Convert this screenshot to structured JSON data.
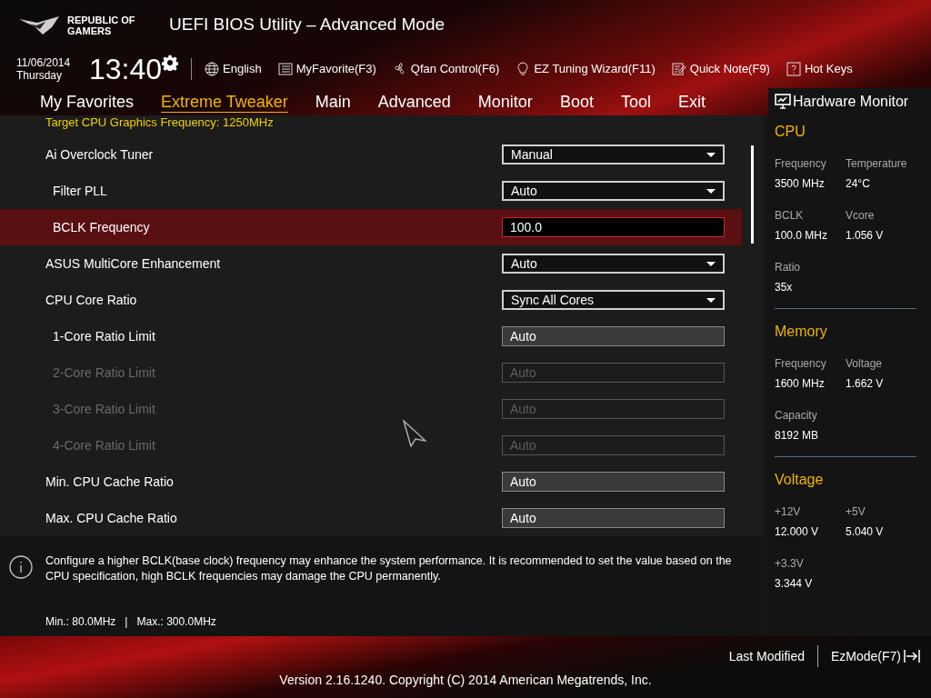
{
  "brand": {
    "line1": "REPUBLIC OF",
    "line2": "GAMERS"
  },
  "window": {
    "title": "UEFI BIOS Utility – Advanced Mode"
  },
  "clock": {
    "date": "11/06/2014",
    "day": "Thursday",
    "time": "13:40"
  },
  "toolbar": [
    "English",
    "MyFavorite(F3)",
    "Qfan Control(F6)",
    "EZ Tuning Wizard(F11)",
    "Quick Note(F9)",
    "Hot Keys"
  ],
  "tabs": [
    {
      "label": "My Favorites",
      "selected": false
    },
    {
      "label": "Extreme Tweaker",
      "selected": true
    },
    {
      "label": "Main",
      "selected": false
    },
    {
      "label": "Advanced",
      "selected": false
    },
    {
      "label": "Monitor",
      "selected": false
    },
    {
      "label": "Boot",
      "selected": false
    },
    {
      "label": "Tool",
      "selected": false
    },
    {
      "label": "Exit",
      "selected": false
    }
  ],
  "top_note": "Target CPU Graphics Frequency: 1250MHz",
  "settings": [
    {
      "label": "Ai Overclock Tuner",
      "value": "Manual",
      "kind": "dropdown",
      "selected": false,
      "disabled": false,
      "children": [
        {
          "label": "Filter PLL",
          "value": "Auto",
          "kind": "dropdown",
          "selected": false,
          "disabled": false
        },
        {
          "label": "BCLK Frequency",
          "value": "100.0",
          "kind": "input",
          "selected": true,
          "disabled": false
        }
      ]
    },
    {
      "label": "ASUS MultiCore Enhancement",
      "value": "Auto",
      "kind": "dropdown",
      "selected": false,
      "disabled": false
    },
    {
      "label": "CPU Core Ratio",
      "value": "Sync All Cores",
      "kind": "dropdown",
      "selected": false,
      "disabled": false,
      "children": [
        {
          "label": "1-Core Ratio Limit",
          "value": "Auto",
          "kind": "box",
          "selected": false,
          "disabled": false
        },
        {
          "label": "2-Core Ratio Limit",
          "value": "Auto",
          "kind": "box",
          "selected": false,
          "disabled": true
        },
        {
          "label": "3-Core Ratio Limit",
          "value": "Auto",
          "kind": "box",
          "selected": false,
          "disabled": true
        },
        {
          "label": "4-Core Ratio Limit",
          "value": "Auto",
          "kind": "box",
          "selected": false,
          "disabled": true
        }
      ]
    },
    {
      "label": "Min. CPU Cache Ratio",
      "value": "Auto",
      "kind": "box",
      "selected": false,
      "disabled": false
    },
    {
      "label": "Max. CPU Cache Ratio",
      "value": "Auto",
      "kind": "box",
      "selected": false,
      "disabled": false
    }
  ],
  "help": {
    "text": "Configure a higher BCLK(base clock) frequency may enhance the system performance. It is recommended to set the value based on the CPU specification, high BCLK frequencies may damage the CPU permanently.",
    "min": "Min.: 80.0MHz",
    "separator": "|",
    "max": "Max.: 300.0MHz"
  },
  "hardware_monitor": {
    "title": "Hardware Monitor",
    "sections": [
      {
        "title": "CPU",
        "items": [
          {
            "label": "Frequency",
            "value": "3500 MHz"
          },
          {
            "label": "Temperature",
            "value": "24°C"
          },
          {
            "label": "BCLK",
            "value": "100.0 MHz"
          },
          {
            "label": "Vcore",
            "value": "1.056 V"
          },
          {
            "label": "Ratio",
            "value": "35x"
          }
        ]
      },
      {
        "title": "Memory",
        "items": [
          {
            "label": "Frequency",
            "value": "1600 MHz"
          },
          {
            "label": "Voltage",
            "value": "1.662 V"
          },
          {
            "label": "Capacity",
            "value": "8192 MB"
          }
        ]
      },
      {
        "title": "Voltage",
        "items": [
          {
            "label": "+12V",
            "value": "12.000 V"
          },
          {
            "label": "+5V",
            "value": "5.040 V"
          },
          {
            "label": "+3.3V",
            "value": "3.344 V"
          }
        ]
      }
    ]
  },
  "footer": {
    "last_modified": "Last Modified",
    "ez_mode": "EzMode(F7)",
    "version": "Version 2.16.1240. Copyright (C) 2014 American Megatrends, Inc."
  }
}
